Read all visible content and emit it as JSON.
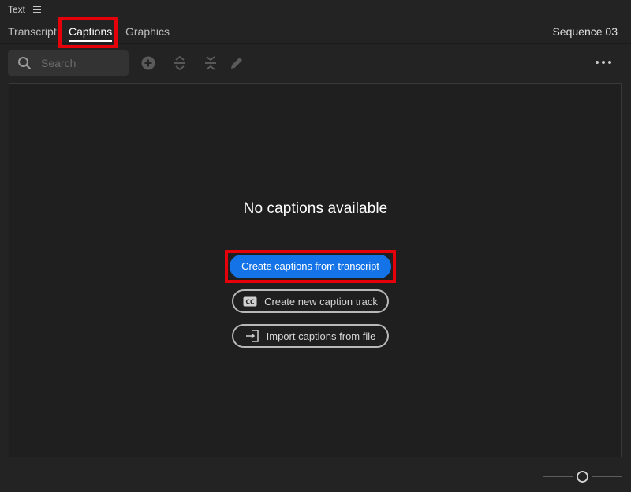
{
  "panel": {
    "title": "Text"
  },
  "tabs": [
    {
      "label": "Transcript"
    },
    {
      "label": "Captions"
    },
    {
      "label": "Graphics"
    }
  ],
  "sequence": {
    "name": "Sequence 03"
  },
  "search": {
    "placeholder": "Search",
    "value": ""
  },
  "toolbar": {
    "icons": [
      "add-icon",
      "expand-icon",
      "collapse-icon",
      "pencil-icon",
      "more-icon"
    ]
  },
  "empty_state": {
    "title": "No captions available",
    "primary_button": "Create captions from transcript",
    "new_track_button": "Create new caption track",
    "import_button": "Import captions from file"
  },
  "zoom": {
    "level": 0.5
  },
  "colors": {
    "accent": "#1473e6",
    "highlight": "#e5000a",
    "background": "#232323"
  }
}
